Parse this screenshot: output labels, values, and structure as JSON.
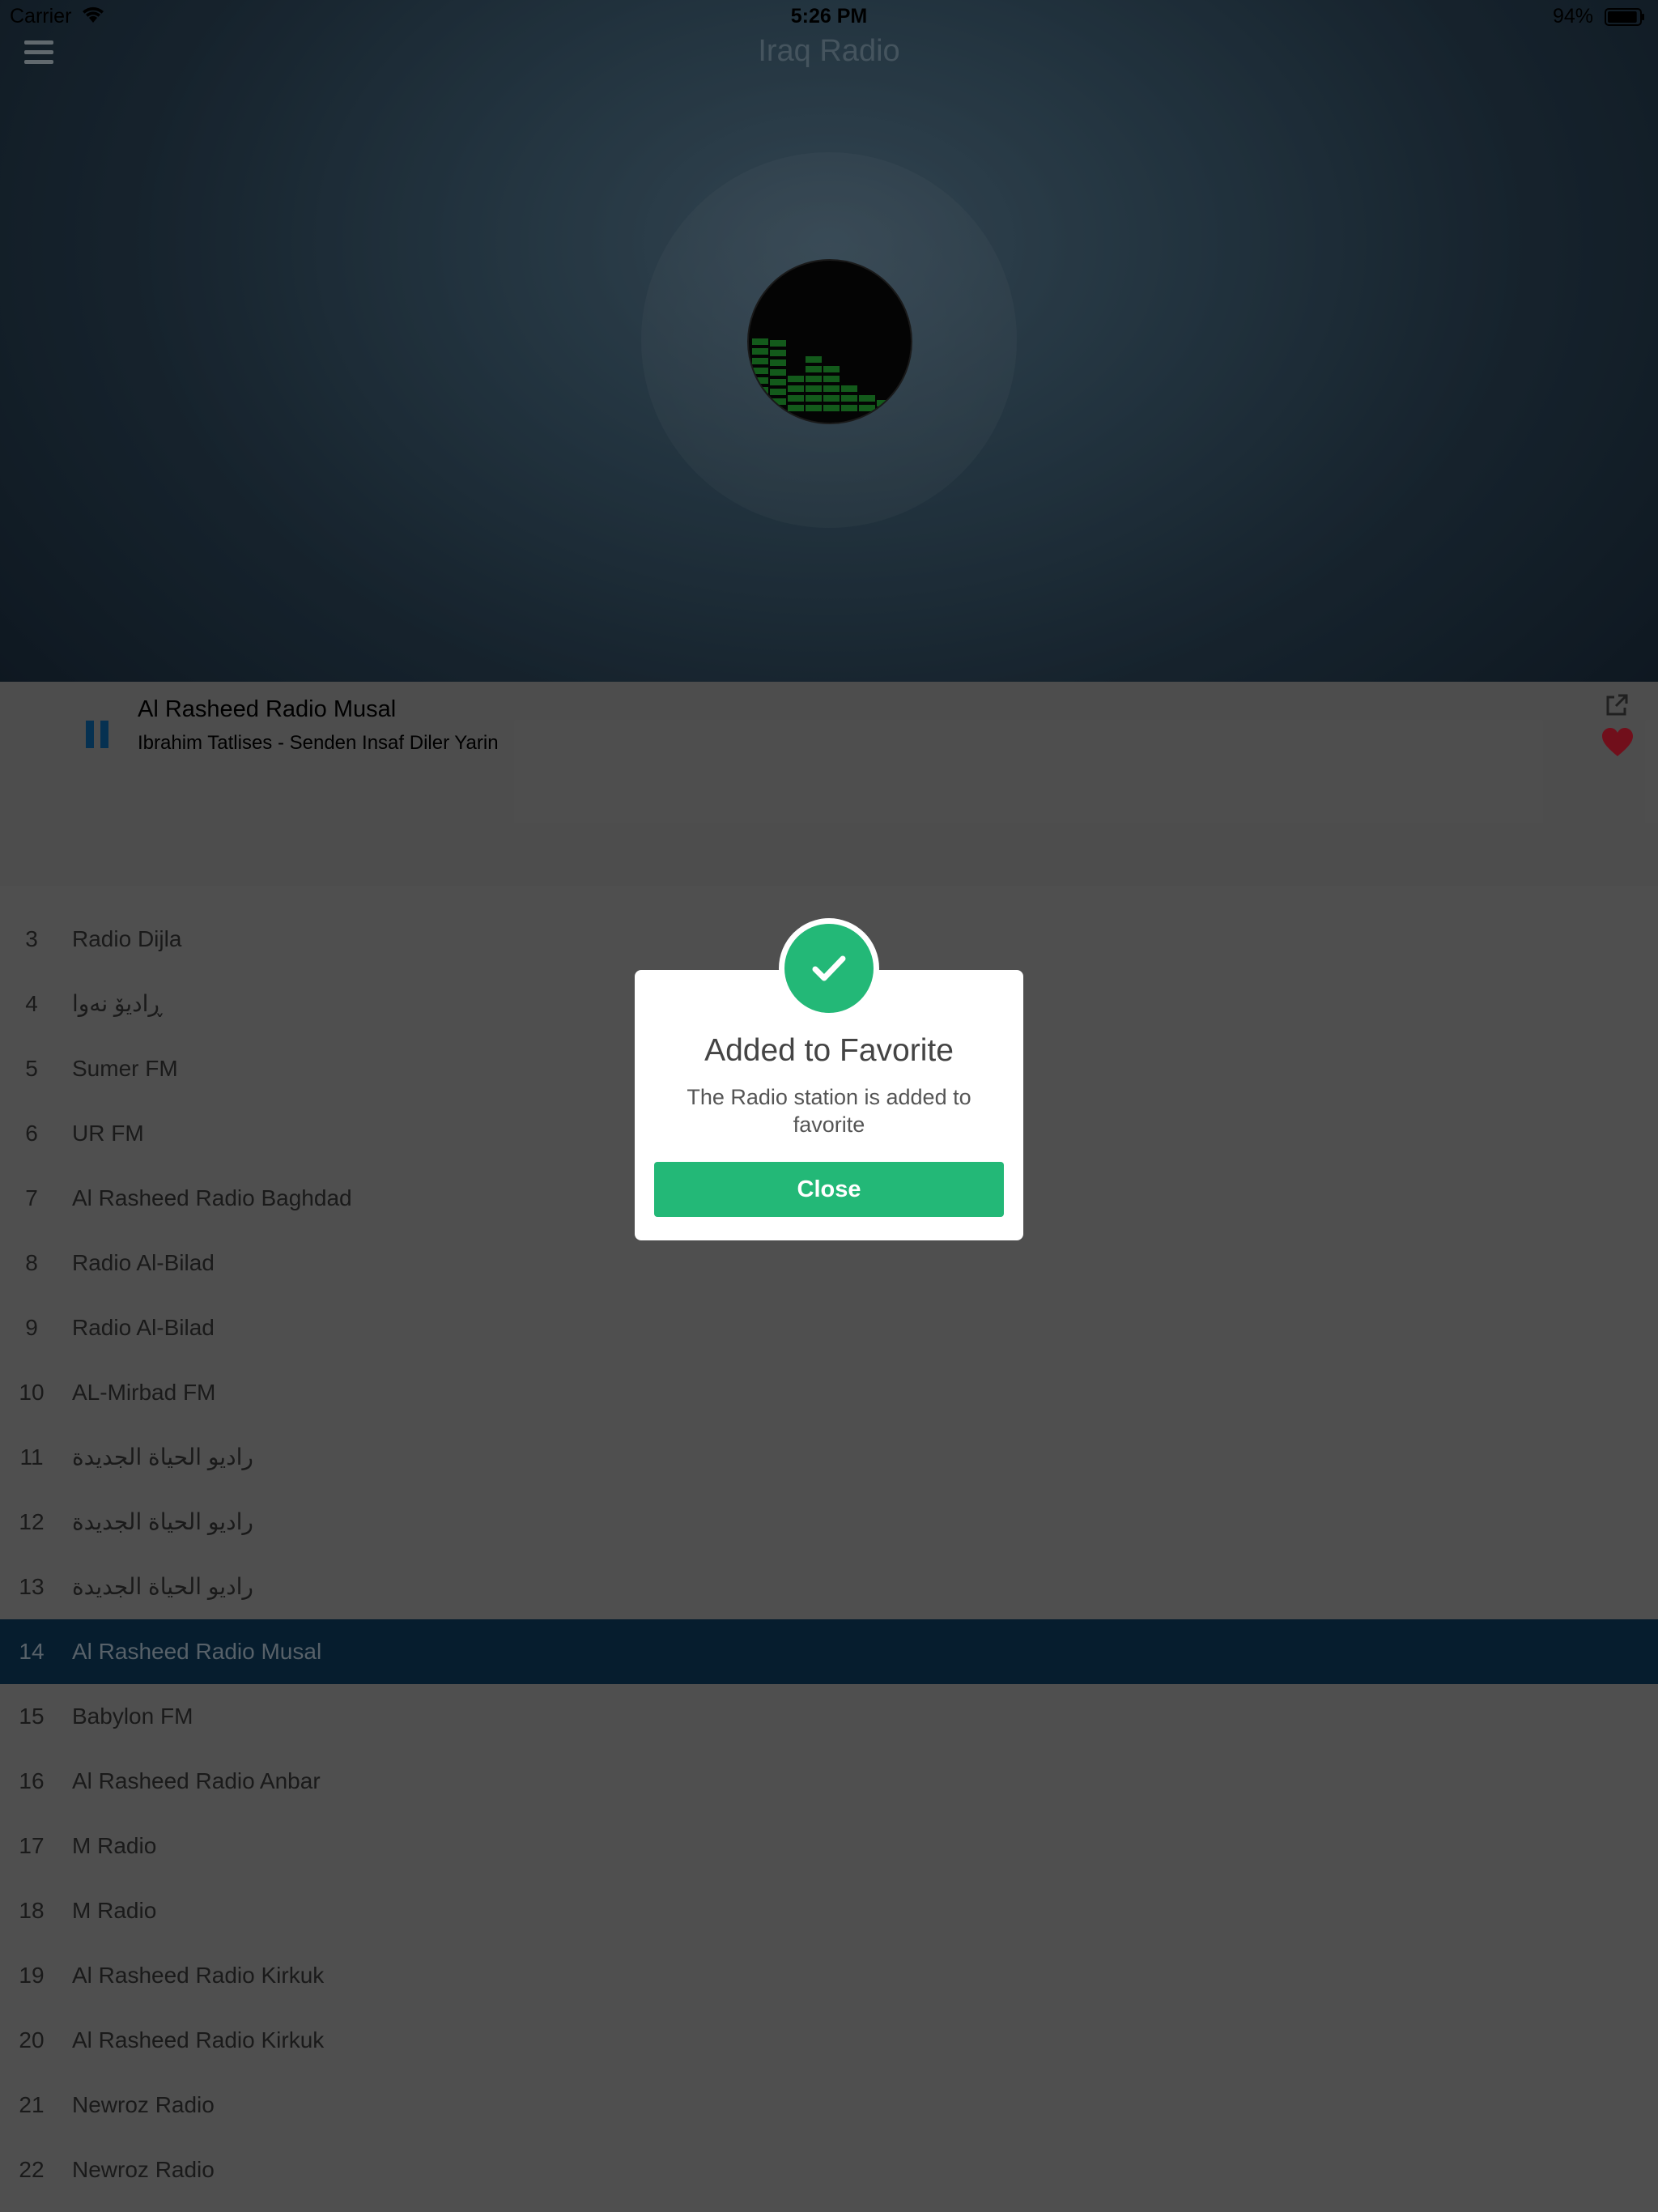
{
  "status_bar": {
    "carrier": "Carrier",
    "time": "5:26 PM",
    "battery": "94%",
    "battery_level": 0.94
  },
  "header": {
    "title": "Iraq Radio",
    "menu_icon": "hamburger-menu-icon"
  },
  "now_playing": {
    "station": "Al Rasheed Radio Musal",
    "track": "Ibrahim Tatlises - Senden Insaf Diler Yarin",
    "state": "playing",
    "favorite": true
  },
  "stations": [
    {
      "number": "3",
      "name": "Radio Dijla"
    },
    {
      "number": "4",
      "name": "ڕادیۆ نەوا"
    },
    {
      "number": "5",
      "name": "Sumer FM"
    },
    {
      "number": "6",
      "name": "UR FM"
    },
    {
      "number": "7",
      "name": "Al Rasheed Radio Baghdad"
    },
    {
      "number": "8",
      "name": "Radio Al-Bilad"
    },
    {
      "number": "9",
      "name": "Radio Al-Bilad"
    },
    {
      "number": "10",
      "name": "AL-Mirbad FM"
    },
    {
      "number": "11",
      "name": "راديو الحياة الجديدة"
    },
    {
      "number": "12",
      "name": "راديو الحياة الجديدة"
    },
    {
      "number": "13",
      "name": "راديو الحياة الجديدة"
    },
    {
      "number": "14",
      "name": "Al Rasheed Radio Musal",
      "selected": true
    },
    {
      "number": "15",
      "name": "Babylon FM"
    },
    {
      "number": "16",
      "name": "Al Rasheed Radio Anbar"
    },
    {
      "number": "17",
      "name": "M Radio"
    },
    {
      "number": "18",
      "name": "M Radio"
    },
    {
      "number": "19",
      "name": "Al Rasheed Radio Kirkuk"
    },
    {
      "number": "20",
      "name": "Al Rasheed Radio Kirkuk"
    },
    {
      "number": "21",
      "name": "Newroz Radio"
    },
    {
      "number": "22",
      "name": "Newroz Radio"
    }
  ],
  "dialog": {
    "title": "Added to Favorite",
    "message": "The Radio station is added to favorite",
    "close_label": "Close"
  },
  "colors": {
    "success_green": "#23b877",
    "selected_row": "#0a2f49",
    "heart_red": "#b3182b",
    "pause_blue": "#0b4e80"
  }
}
